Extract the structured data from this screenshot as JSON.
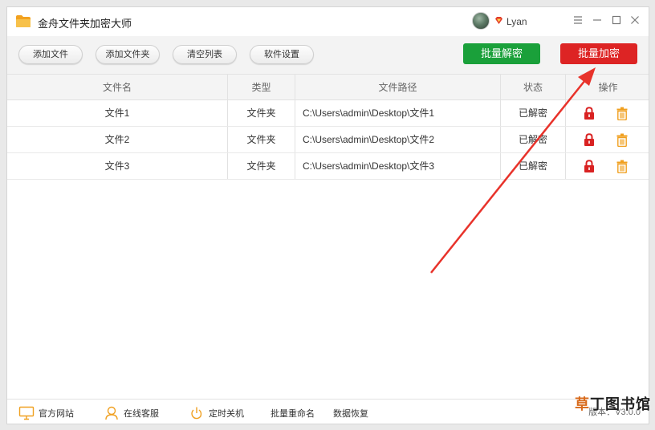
{
  "app": {
    "title": "金舟文件夹加密大师"
  },
  "user": {
    "name": "Lyan"
  },
  "toolbar": {
    "add_file": "添加文件",
    "add_folder": "添加文件夹",
    "clear_list": "清空列表",
    "settings": "软件设置",
    "batch_decrypt": "批量解密",
    "batch_encrypt": "批量加密"
  },
  "table": {
    "headers": [
      "文件名",
      "类型",
      "文件路径",
      "状态",
      "操作"
    ],
    "rows": [
      {
        "name": "文件1",
        "type": "文件夹",
        "path": "C:\\Users\\admin\\Desktop\\文件1",
        "status": "已解密"
      },
      {
        "name": "文件2",
        "type": "文件夹",
        "path": "C:\\Users\\admin\\Desktop\\文件2",
        "status": "已解密"
      },
      {
        "name": "文件3",
        "type": "文件夹",
        "path": "C:\\Users\\admin\\Desktop\\文件3",
        "status": "已解密"
      }
    ]
  },
  "footer": {
    "website": "官方网站",
    "support": "在线客服",
    "shutdown": "定时关机",
    "rename": "批量重命名",
    "recovery": "数据恢复",
    "version": "版本：V3.0.0"
  },
  "watermark": {
    "part1": "草",
    "part2": "丁图书馆"
  },
  "colors": {
    "decrypt": "#1aa03a",
    "encrypt": "#dd2424",
    "lock": "#d92222",
    "trash": "#f0a020",
    "arrow": "#e8322a"
  },
  "icons": [
    "folder-logo-icon",
    "vip-diamond-icon",
    "menu-icon",
    "minimize-icon",
    "maximize-icon",
    "close-icon",
    "lock-icon",
    "trash-icon",
    "monitor-icon",
    "headset-icon",
    "power-icon"
  ]
}
